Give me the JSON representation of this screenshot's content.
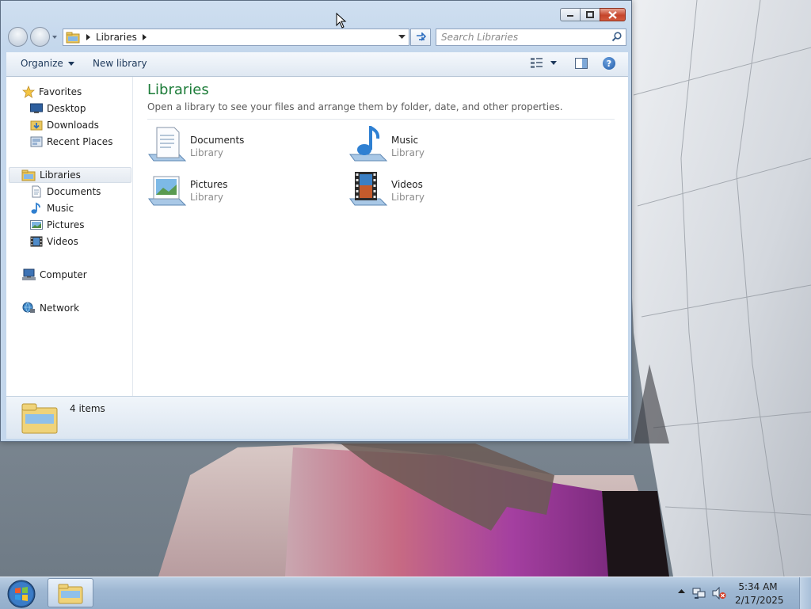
{
  "window": {
    "address": {
      "crumb": "Libraries"
    },
    "search": {
      "placeholder": "Search Libraries"
    },
    "commands": {
      "organize": "Organize",
      "new_library": "New library"
    },
    "navigation": {
      "favorites": "Favorites",
      "desktop": "Desktop",
      "downloads": "Downloads",
      "recent_places": "Recent Places",
      "libraries": "Libraries",
      "documents": "Documents",
      "music": "Music",
      "pictures": "Pictures",
      "videos": "Videos",
      "computer": "Computer",
      "network": "Network"
    },
    "content": {
      "title": "Libraries",
      "subtitle": "Open a library to see your files and arrange them by folder, date, and other properties.",
      "items": [
        {
          "name": "Documents",
          "kind": "Library",
          "icon": "documents-library-icon"
        },
        {
          "name": "Music",
          "kind": "Library",
          "icon": "music-library-icon"
        },
        {
          "name": "Pictures",
          "kind": "Library",
          "icon": "pictures-library-icon"
        },
        {
          "name": "Videos",
          "kind": "Library",
          "icon": "videos-library-icon"
        }
      ]
    },
    "details": {
      "count": "4 items"
    }
  },
  "taskbar": {
    "clock": {
      "time": "5:34 AM",
      "date": "2/17/2025"
    }
  },
  "colors": {
    "accent_title": "#1e7d3a",
    "close_button": "#c6452c"
  }
}
